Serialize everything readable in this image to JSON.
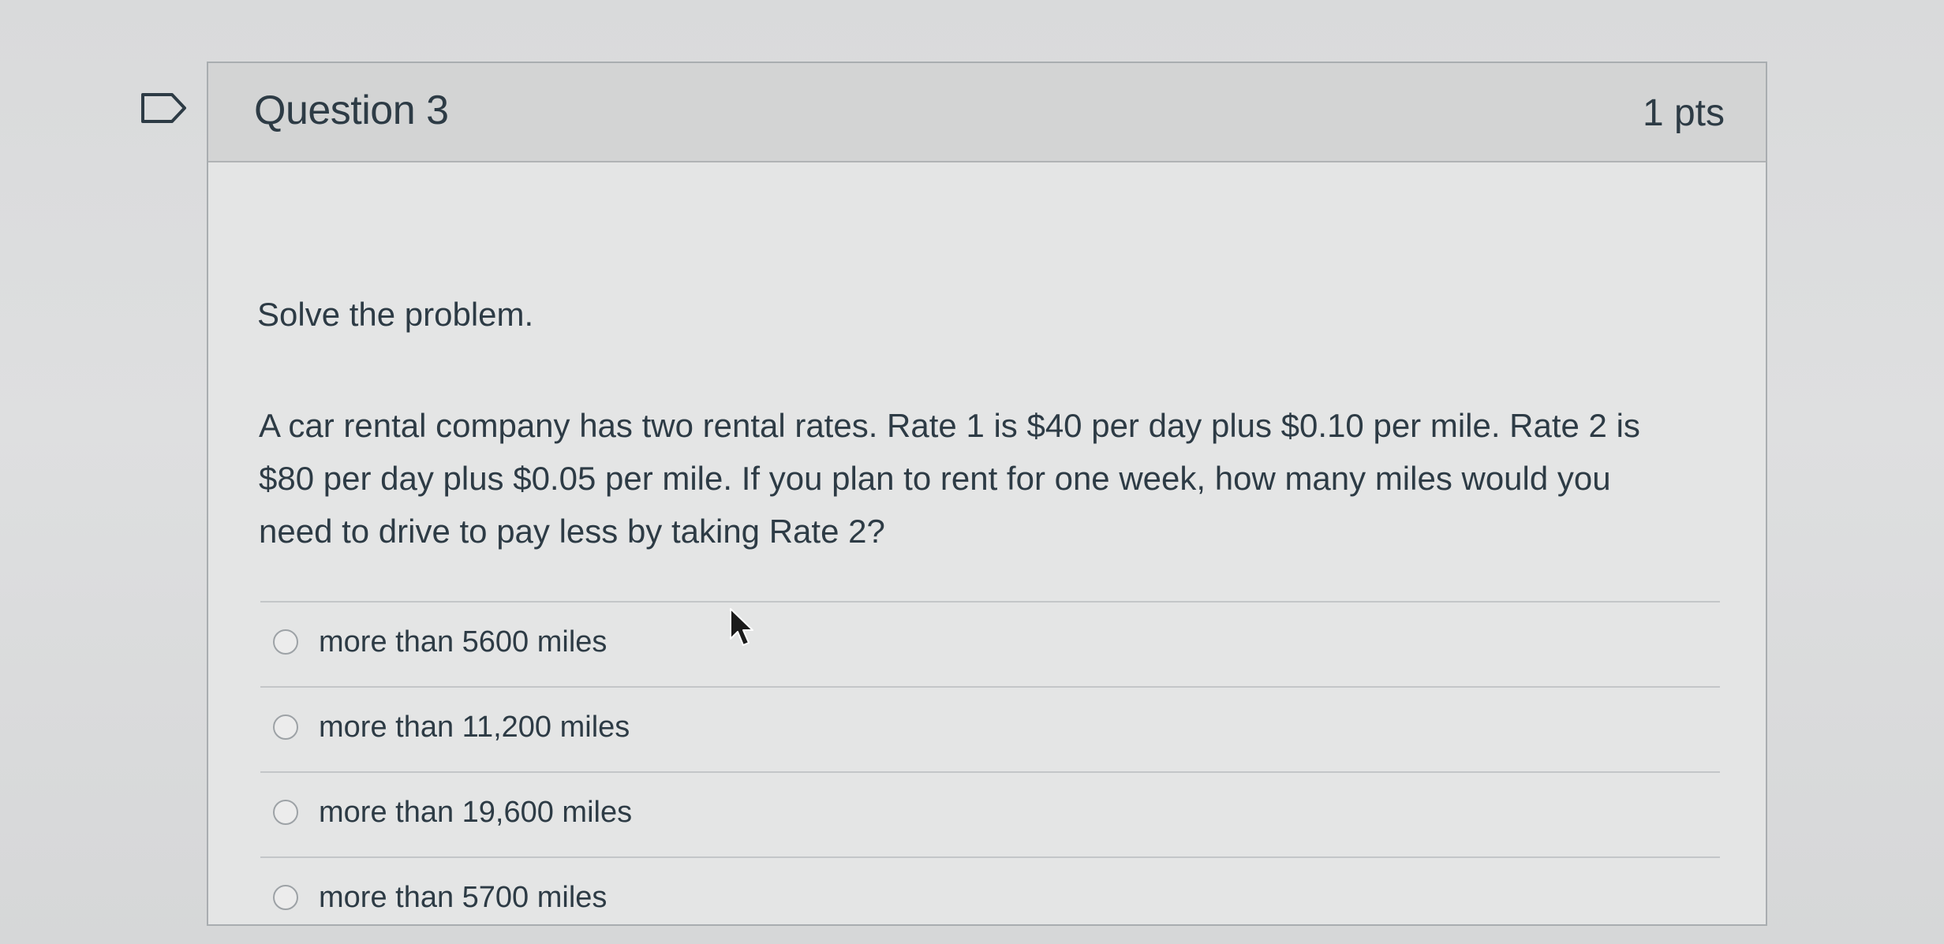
{
  "question": {
    "title": "Question 3",
    "points": "1 pts",
    "instruction": "Solve the problem.",
    "problem": "A car rental company has two rental rates. Rate 1 is $40 per day plus $0.10 per mile. Rate 2 is $80 per day plus $0.05 per mile. If you plan to rent for one week, how many miles would you need to drive to pay less by taking Rate 2?",
    "answers": [
      {
        "label": "more than 5600 miles"
      },
      {
        "label": "more than 11,200 miles"
      },
      {
        "label": "more than 19,600 miles"
      },
      {
        "label": "more than 5700 miles"
      }
    ]
  },
  "icons": {
    "flag": "flag-question-icon",
    "cursor": "mouse-pointer-icon",
    "radio": "radio-unselected-icon"
  },
  "colors": {
    "text": "#2d3b45",
    "header_bg": "#d3d4d4",
    "card_bg": "#e4e5e5",
    "border": "#a9adb0"
  }
}
